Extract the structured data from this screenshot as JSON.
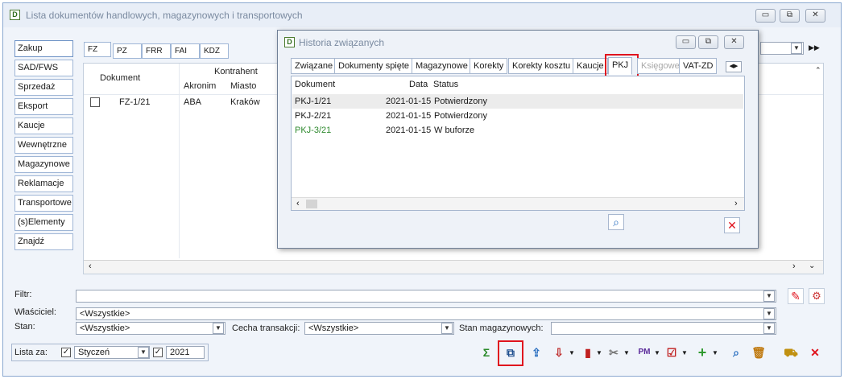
{
  "window": {
    "title": "Lista dokumentów handlowych, magazynowych i transportowych",
    "minimize": "▭",
    "maximize": "⧉",
    "close": "✕"
  },
  "sidebar": {
    "items": [
      "Zakup",
      "SAD/FWS",
      "Sprzedaż",
      "Eksport",
      "Kaucje",
      "Wewnętrzne",
      "Magazynowe",
      "Reklamacje",
      "Transportowe",
      "(s)Elementy",
      "Znajdź"
    ]
  },
  "subtabs": [
    "FZ",
    "PZ",
    "FRR",
    "FAI",
    "KDZ"
  ],
  "grid": {
    "header_dokument": "Dokument",
    "header_kontrahent": "Kontrahent",
    "header_akronim": "Akronim",
    "header_miasto": "Miasto",
    "rows": [
      {
        "dokument": "FZ-1/21",
        "akronim": "ABA",
        "miasto": "Kraków"
      }
    ]
  },
  "filters": {
    "filtr_label": "Filtr:",
    "wlasciciel_label": "Właściciel:",
    "wlasciciel_value": "<Wszystkie>",
    "stan_label": "Stan:",
    "stan_value": "<Wszystkie>",
    "cecha_label": "Cecha transakcji:",
    "cecha_value": "<Wszystkie>",
    "stan_mag_label": "Stan magazynowych:"
  },
  "bottom": {
    "lista_za_label": "Lista za:",
    "month": "Styczeń",
    "year": "2021"
  },
  "popup": {
    "title": "Historia związanych",
    "tabs": [
      "Związane",
      "Dokumenty spięte",
      "Magazynowe",
      "Korekty",
      "Korekty kosztu",
      "Kaucje",
      "PKJ",
      "Księgowe",
      "VAT-ZD"
    ],
    "columns": {
      "dokument": "Dokument",
      "data": "Data",
      "status": "Status"
    },
    "rows": [
      {
        "dokument": "PKJ-1/21",
        "data": "2021-01-15",
        "status": "Potwierdzony"
      },
      {
        "dokument": "PKJ-2/21",
        "data": "2021-01-15",
        "status": "Potwierdzony"
      },
      {
        "dokument": "PKJ-3/21",
        "data": "2021-01-15",
        "status": "W buforze"
      }
    ]
  },
  "colors": {
    "accent_green": "#2f8a2f",
    "highlight_red": "#e0141e",
    "row_alt": "#ececec"
  }
}
